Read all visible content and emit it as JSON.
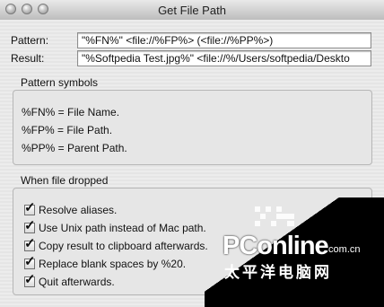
{
  "window": {
    "title": "Get File Path",
    "controls": [
      "close-dot",
      "minimize-dot",
      "zoom-dot"
    ]
  },
  "form": {
    "pattern_label": "Pattern:",
    "pattern_value": "\"%FN%\" <file://%FP%> (<file://%PP%>)",
    "result_label": "Result:",
    "result_value": "\"%Softpedia Test.jpg%\" <file://%/Users/softpedia/Deskto"
  },
  "symbols": {
    "title": "Pattern symbols",
    "items": [
      "%FN% = File Name.",
      "%FP% = File Path.",
      "%PP% = Parent Path."
    ]
  },
  "dropped": {
    "title": "When file dropped",
    "options": [
      {
        "label": "Resolve aliases.",
        "checked": true
      },
      {
        "label": "Use Unix path instead of Mac path.",
        "checked": true
      },
      {
        "label": "Copy result to clipboard afterwards.",
        "checked": true
      },
      {
        "label": "Replace blank spaces by %20.",
        "checked": true
      },
      {
        "label": "Quit afterwards.",
        "checked": true
      }
    ]
  },
  "watermark": {
    "logo_text": "PConline",
    "logo_domain": ".com.cn",
    "logo_cn": "太平洋电脑网"
  },
  "colors": {
    "window_bg": "#e8e8e8",
    "group_border": "#b6b6b6",
    "watermark_bg": "#000000"
  }
}
